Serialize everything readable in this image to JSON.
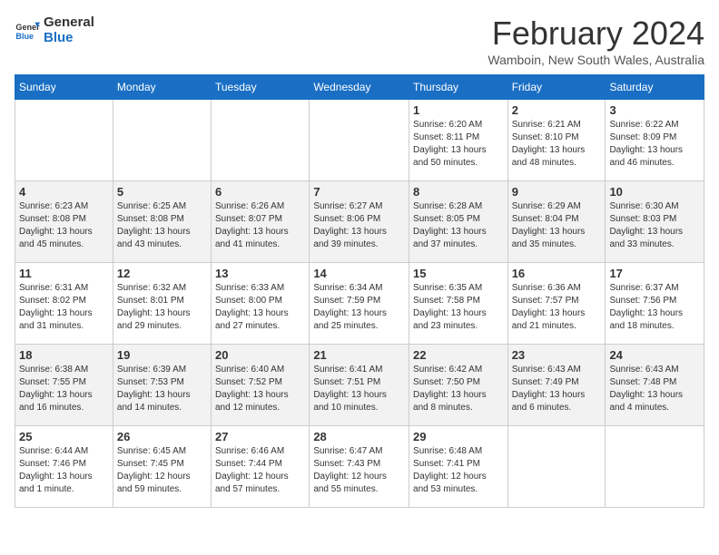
{
  "header": {
    "logo_line1": "General",
    "logo_line2": "Blue",
    "month": "February 2024",
    "location": "Wamboin, New South Wales, Australia"
  },
  "weekdays": [
    "Sunday",
    "Monday",
    "Tuesday",
    "Wednesday",
    "Thursday",
    "Friday",
    "Saturday"
  ],
  "weeks": [
    [
      {
        "day": "",
        "info": ""
      },
      {
        "day": "",
        "info": ""
      },
      {
        "day": "",
        "info": ""
      },
      {
        "day": "",
        "info": ""
      },
      {
        "day": "1",
        "info": "Sunrise: 6:20 AM\nSunset: 8:11 PM\nDaylight: 13 hours\nand 50 minutes."
      },
      {
        "day": "2",
        "info": "Sunrise: 6:21 AM\nSunset: 8:10 PM\nDaylight: 13 hours\nand 48 minutes."
      },
      {
        "day": "3",
        "info": "Sunrise: 6:22 AM\nSunset: 8:09 PM\nDaylight: 13 hours\nand 46 minutes."
      }
    ],
    [
      {
        "day": "4",
        "info": "Sunrise: 6:23 AM\nSunset: 8:08 PM\nDaylight: 13 hours\nand 45 minutes."
      },
      {
        "day": "5",
        "info": "Sunrise: 6:25 AM\nSunset: 8:08 PM\nDaylight: 13 hours\nand 43 minutes."
      },
      {
        "day": "6",
        "info": "Sunrise: 6:26 AM\nSunset: 8:07 PM\nDaylight: 13 hours\nand 41 minutes."
      },
      {
        "day": "7",
        "info": "Sunrise: 6:27 AM\nSunset: 8:06 PM\nDaylight: 13 hours\nand 39 minutes."
      },
      {
        "day": "8",
        "info": "Sunrise: 6:28 AM\nSunset: 8:05 PM\nDaylight: 13 hours\nand 37 minutes."
      },
      {
        "day": "9",
        "info": "Sunrise: 6:29 AM\nSunset: 8:04 PM\nDaylight: 13 hours\nand 35 minutes."
      },
      {
        "day": "10",
        "info": "Sunrise: 6:30 AM\nSunset: 8:03 PM\nDaylight: 13 hours\nand 33 minutes."
      }
    ],
    [
      {
        "day": "11",
        "info": "Sunrise: 6:31 AM\nSunset: 8:02 PM\nDaylight: 13 hours\nand 31 minutes."
      },
      {
        "day": "12",
        "info": "Sunrise: 6:32 AM\nSunset: 8:01 PM\nDaylight: 13 hours\nand 29 minutes."
      },
      {
        "day": "13",
        "info": "Sunrise: 6:33 AM\nSunset: 8:00 PM\nDaylight: 13 hours\nand 27 minutes."
      },
      {
        "day": "14",
        "info": "Sunrise: 6:34 AM\nSunset: 7:59 PM\nDaylight: 13 hours\nand 25 minutes."
      },
      {
        "day": "15",
        "info": "Sunrise: 6:35 AM\nSunset: 7:58 PM\nDaylight: 13 hours\nand 23 minutes."
      },
      {
        "day": "16",
        "info": "Sunrise: 6:36 AM\nSunset: 7:57 PM\nDaylight: 13 hours\nand 21 minutes."
      },
      {
        "day": "17",
        "info": "Sunrise: 6:37 AM\nSunset: 7:56 PM\nDaylight: 13 hours\nand 18 minutes."
      }
    ],
    [
      {
        "day": "18",
        "info": "Sunrise: 6:38 AM\nSunset: 7:55 PM\nDaylight: 13 hours\nand 16 minutes."
      },
      {
        "day": "19",
        "info": "Sunrise: 6:39 AM\nSunset: 7:53 PM\nDaylight: 13 hours\nand 14 minutes."
      },
      {
        "day": "20",
        "info": "Sunrise: 6:40 AM\nSunset: 7:52 PM\nDaylight: 13 hours\nand 12 minutes."
      },
      {
        "day": "21",
        "info": "Sunrise: 6:41 AM\nSunset: 7:51 PM\nDaylight: 13 hours\nand 10 minutes."
      },
      {
        "day": "22",
        "info": "Sunrise: 6:42 AM\nSunset: 7:50 PM\nDaylight: 13 hours\nand 8 minutes."
      },
      {
        "day": "23",
        "info": "Sunrise: 6:43 AM\nSunset: 7:49 PM\nDaylight: 13 hours\nand 6 minutes."
      },
      {
        "day": "24",
        "info": "Sunrise: 6:43 AM\nSunset: 7:48 PM\nDaylight: 13 hours\nand 4 minutes."
      }
    ],
    [
      {
        "day": "25",
        "info": "Sunrise: 6:44 AM\nSunset: 7:46 PM\nDaylight: 13 hours\nand 1 minute."
      },
      {
        "day": "26",
        "info": "Sunrise: 6:45 AM\nSunset: 7:45 PM\nDaylight: 12 hours\nand 59 minutes."
      },
      {
        "day": "27",
        "info": "Sunrise: 6:46 AM\nSunset: 7:44 PM\nDaylight: 12 hours\nand 57 minutes."
      },
      {
        "day": "28",
        "info": "Sunrise: 6:47 AM\nSunset: 7:43 PM\nDaylight: 12 hours\nand 55 minutes."
      },
      {
        "day": "29",
        "info": "Sunrise: 6:48 AM\nSunset: 7:41 PM\nDaylight: 12 hours\nand 53 minutes."
      },
      {
        "day": "",
        "info": ""
      },
      {
        "day": "",
        "info": ""
      }
    ]
  ]
}
